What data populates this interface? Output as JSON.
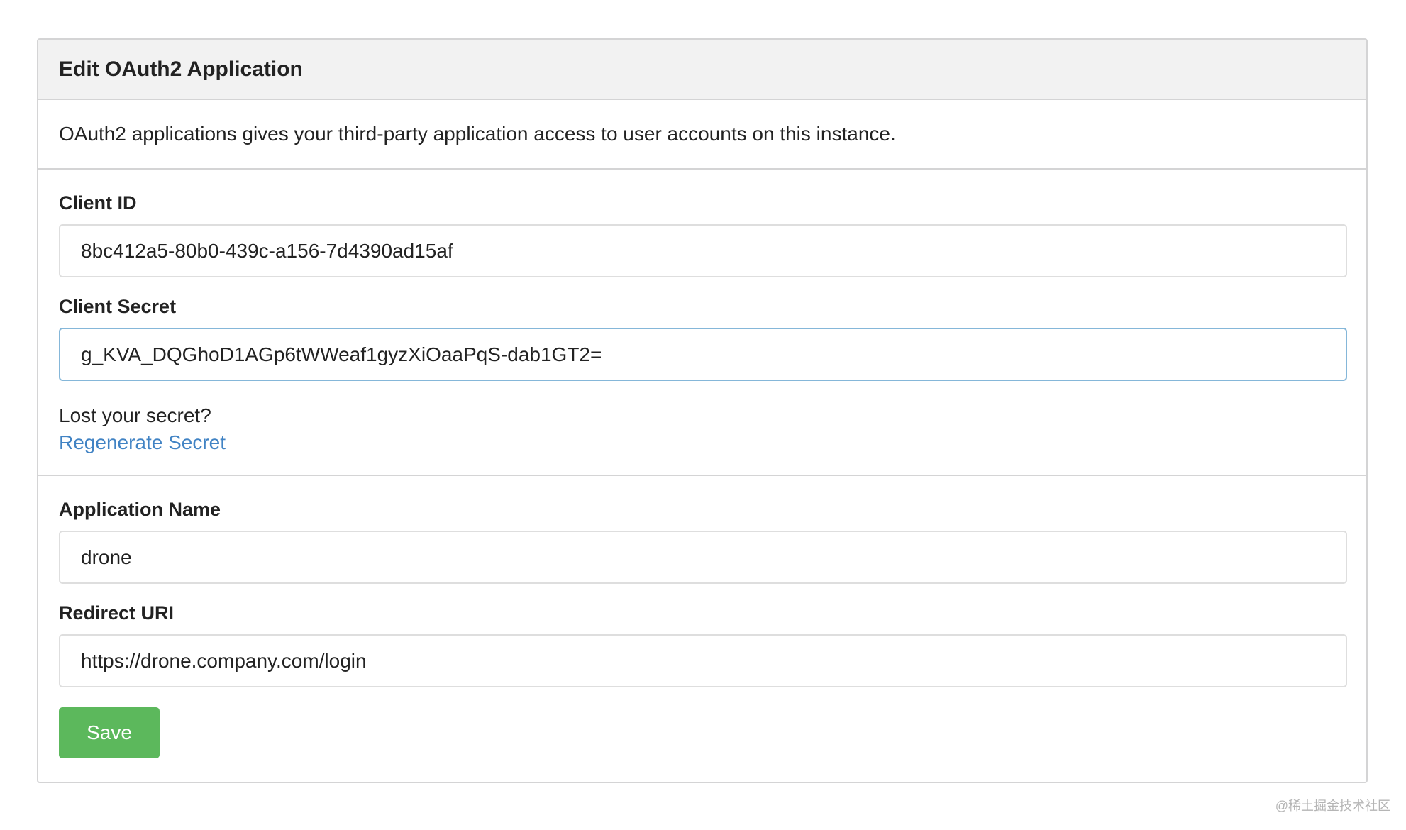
{
  "panel": {
    "title": "Edit OAuth2 Application",
    "description": "OAuth2 applications gives your third-party application access to user accounts on this instance."
  },
  "client": {
    "id_label": "Client ID",
    "id_value": "8bc412a5-80b0-439c-a156-7d4390ad15af",
    "secret_label": "Client Secret",
    "secret_value": "g_KVA_DQGhoD1AGp6tWWeaf1gyzXiOaaPqS-dab1GT2=",
    "lost_text": "Lost your secret?",
    "regenerate_label": "Regenerate Secret"
  },
  "app": {
    "name_label": "Application Name",
    "name_value": "drone",
    "redirect_label": "Redirect URI",
    "redirect_value": "https://drone.company.com/login",
    "save_label": "Save"
  },
  "watermark": "@稀土掘金技术社区",
  "colors": {
    "header_bg": "#f2f2f2",
    "border": "#d4d4d5",
    "link": "#4183c4",
    "save_button": "#5cb85c",
    "focus_border": "#85b7d9"
  }
}
